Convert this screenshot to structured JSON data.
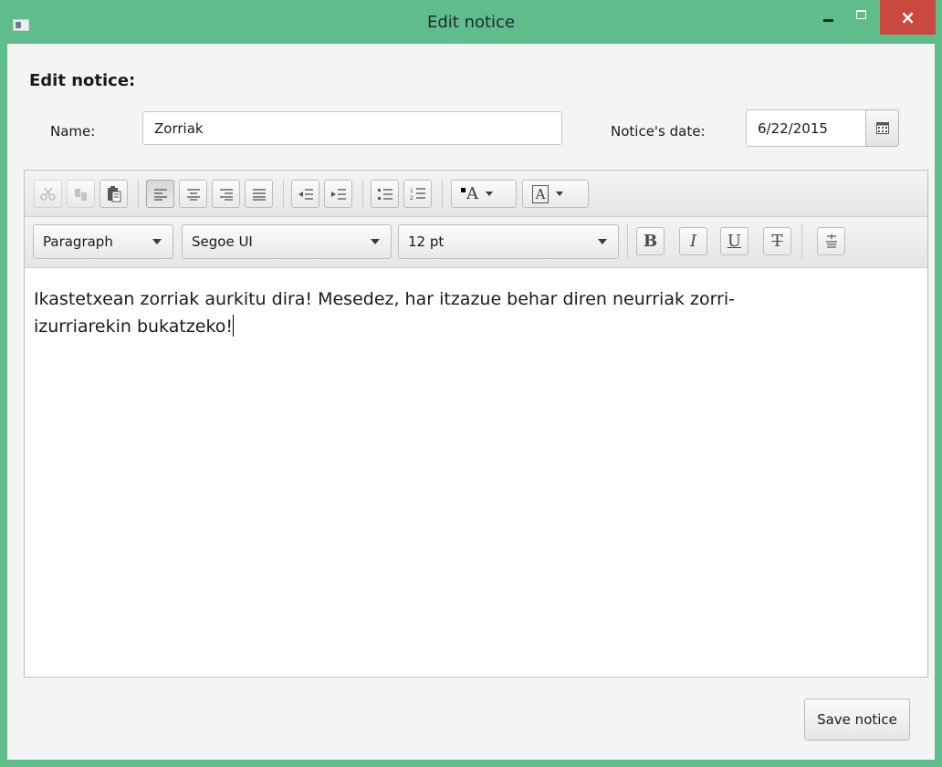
{
  "window": {
    "title": "Edit notice",
    "close_glyph": "×"
  },
  "form": {
    "heading": "Edit notice:",
    "name_label": "Name:",
    "name_value": "Zorriak",
    "date_label": "Notice's date:",
    "date_value": "6/22/2015"
  },
  "toolbar": {
    "icons": [
      "cut-icon",
      "copy-icon",
      "paste-icon",
      "align-left-icon",
      "align-center-icon",
      "align-right-icon",
      "align-justify-icon",
      "outdent-icon",
      "indent-icon",
      "bullets-icon",
      "numbers-icon",
      "text-color-icon",
      "background-color-icon"
    ],
    "text_color_glyph": "A",
    "bg_color_glyph": "A"
  },
  "format_bar": {
    "paragraph": "Paragraph",
    "font": "Segoe UI",
    "size": "12 pt",
    "bold_glyph": "B",
    "italic_glyph": "I",
    "underline_glyph": "U",
    "strike_glyph": "T"
  },
  "editor": {
    "line1": "Ikastetxean zorriak aurkitu dira! Mesedez, har itzazue behar diren neurriak zorri-",
    "line2": "izurriarekin bukatzeko!"
  },
  "actions": {
    "save_label": "Save notice"
  },
  "colors": {
    "frame": "#5ebd8b",
    "close": "#c9493f"
  }
}
